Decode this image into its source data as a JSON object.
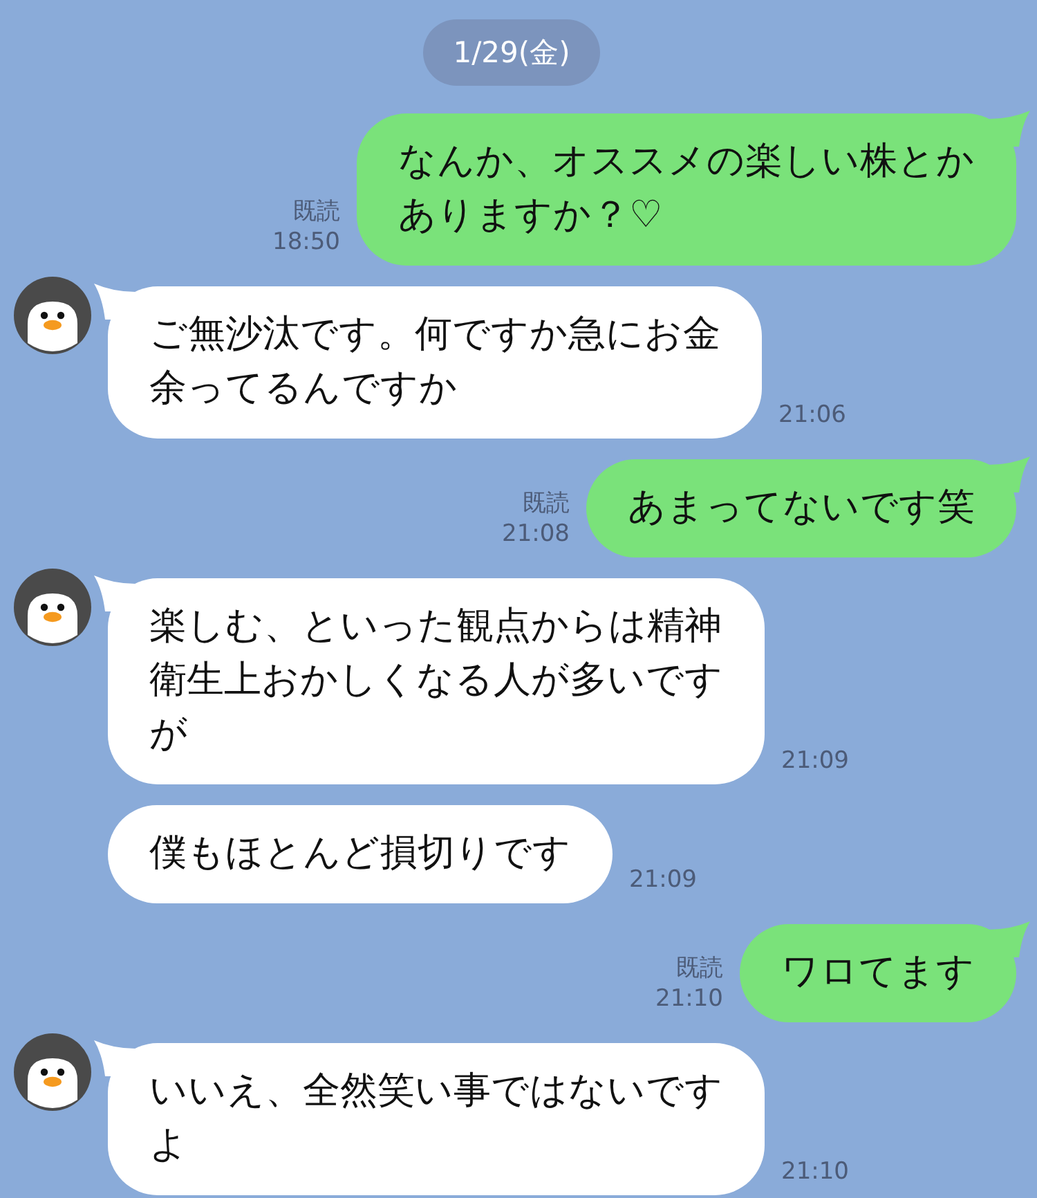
{
  "date": "1/29(金)",
  "messages": [
    {
      "kind": "outgoing",
      "lines": [
        "なんか、オススメの楽しい株とか",
        "ありますか？♡"
      ],
      "read": "既読",
      "time": "18:50"
    },
    {
      "kind": "incoming",
      "avatar": true,
      "lines": [
        "ご無沙汰です。何ですか急にお金",
        "余ってるんですか"
      ],
      "time": "21:06"
    },
    {
      "kind": "outgoing",
      "lines": [
        "あまってないです笑"
      ],
      "read": "既読",
      "time": "21:08"
    },
    {
      "kind": "incoming",
      "avatar": true,
      "lines": [
        "楽しむ、といった観点からは精神",
        "衛生上おかしくなる人が多いです",
        "が"
      ],
      "time": "21:09"
    },
    {
      "kind": "incoming",
      "avatar": false,
      "lines": [
        "僕もほとんど損切りです"
      ],
      "time": "21:09"
    },
    {
      "kind": "outgoing",
      "lines": [
        "ワロてます"
      ],
      "read": "既読",
      "time": "21:10"
    },
    {
      "kind": "incoming",
      "avatar": true,
      "lines": [
        "いいえ、全然笑い事ではないです",
        "よ"
      ],
      "time": "21:10"
    }
  ]
}
